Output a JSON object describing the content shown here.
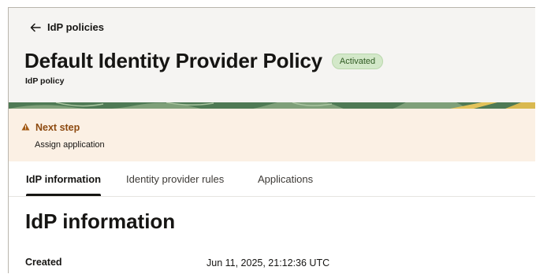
{
  "nav": {
    "back_label": "IdP policies"
  },
  "header": {
    "title": "Default Identity Provider Policy",
    "status_badge": "Activated",
    "subtitle": "IdP policy"
  },
  "next_step": {
    "title": "Next step",
    "message": "Assign application"
  },
  "tabs": [
    {
      "label": "IdP information",
      "active": true
    },
    {
      "label": "Identity provider rules",
      "active": false
    },
    {
      "label": "Applications",
      "active": false
    }
  ],
  "section": {
    "title": "IdP information",
    "fields": [
      {
        "label": "Created",
        "value": "Jun 11, 2025, 21:12:36 UTC"
      }
    ]
  },
  "colors": {
    "accent_dark": "#161513",
    "badge_bg": "#d3e8c9",
    "warning_text": "#8d4a10",
    "warning_bg": "#fbf0e4",
    "banner_green": "#4f7a55"
  },
  "icons": {
    "back": "arrow-left-icon",
    "warning": "warning-triangle-icon"
  }
}
